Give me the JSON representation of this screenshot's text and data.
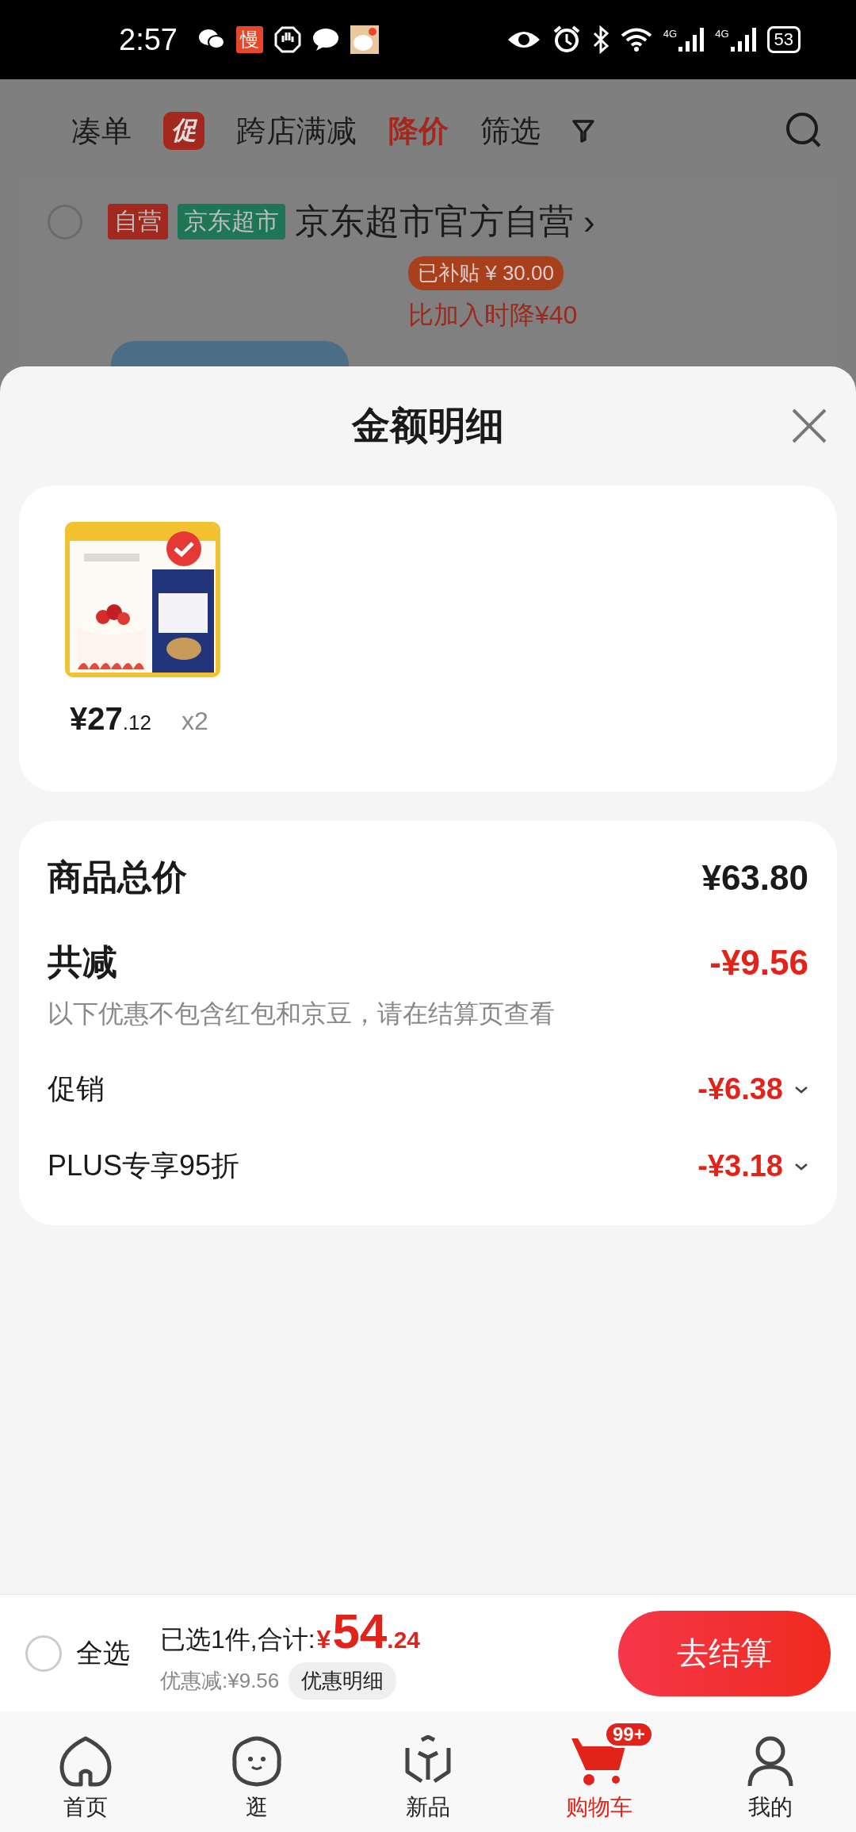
{
  "status_bar": {
    "time": "2:57",
    "app_badge": "慢",
    "network": [
      "4G",
      "4G"
    ],
    "battery": "53"
  },
  "background_page": {
    "filters": [
      {
        "label": "凑单",
        "kind": "text",
        "selected": false
      },
      {
        "label": "跨店满减",
        "kind": "promo",
        "badge": "促",
        "selected": false
      },
      {
        "label": "降价",
        "kind": "text",
        "selected": true
      },
      {
        "label": "筛选",
        "kind": "filter",
        "selected": false
      }
    ],
    "store": {
      "checked": false,
      "tags": [
        {
          "label": "自营",
          "color": "#a3291e"
        },
        {
          "label": "京东超市",
          "color": "#1e7656"
        }
      ],
      "name": "京东超市官方自营",
      "arrow": "›"
    },
    "subsidy": "已补贴 ¥ 30.00",
    "price_drop": "比加入时降¥40"
  },
  "sheet": {
    "title": "金额明细",
    "items": [
      {
        "kind": "picture",
        "price_main": "¥27",
        "price_cents": ".12",
        "quantity": "x2"
      }
    ],
    "summary": {
      "total_label": "商品总价",
      "total": "¥63.80",
      "discount_label": "共减",
      "discount": "-¥9.56",
      "note": "以下优惠不包含红包和京豆，请在结算页查看",
      "discounts": [
        {
          "label": "促销",
          "amount": "-¥6.38",
          "expanded": false
        },
        {
          "label": "PLUS专享95折",
          "amount": "-¥3.18",
          "expanded": false
        }
      ]
    }
  },
  "footer": {
    "select_all": {
      "label": "全选",
      "checked": false
    },
    "summary": "已选1件,合计:",
    "currency": "¥",
    "total_main": "54",
    "total_cents": ".24",
    "saving": "优惠减:¥9.56",
    "detail_button": "优惠明细",
    "checkout": "去结算"
  },
  "tabs": [
    {
      "label": "首页",
      "kind": "home",
      "selected": false
    },
    {
      "label": "逛",
      "kind": "browse",
      "selected": false
    },
    {
      "label": "新品",
      "kind": "new",
      "selected": false
    },
    {
      "label": "购物车",
      "kind": "cart",
      "selected": true,
      "badge": "99+"
    },
    {
      "label": "我的",
      "kind": "me",
      "selected": false
    }
  ]
}
